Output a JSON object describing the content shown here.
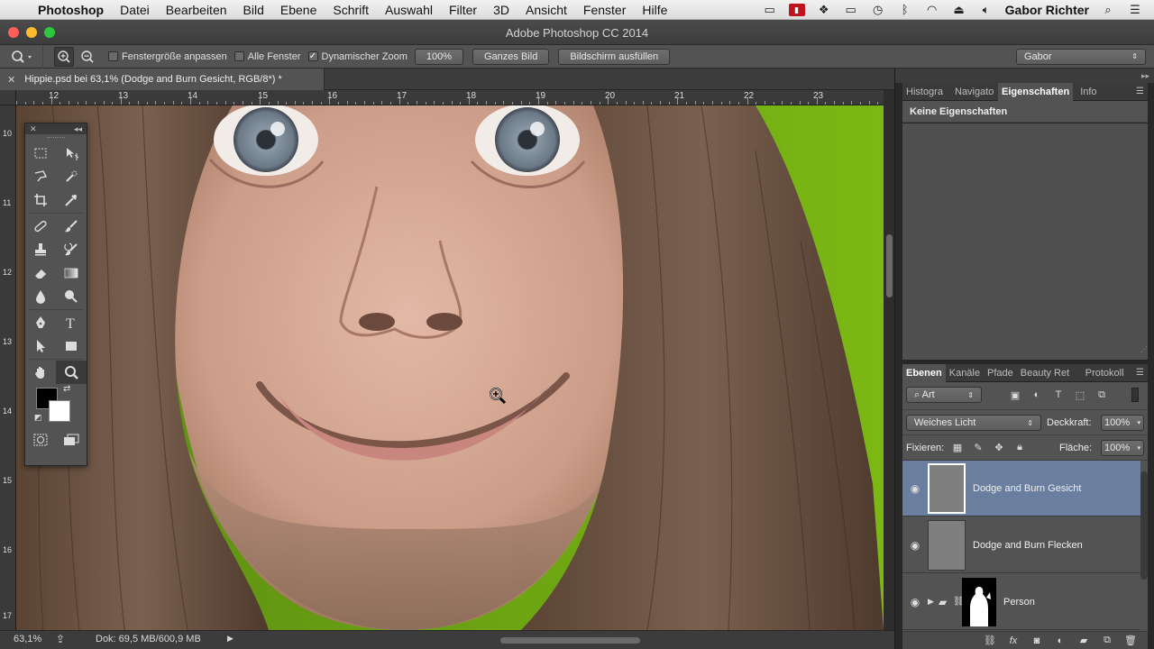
{
  "menubar": {
    "app": "Photoshop",
    "items": [
      "Datei",
      "Bearbeiten",
      "Bild",
      "Ebene",
      "Schrift",
      "Auswahl",
      "Filter",
      "3D",
      "Ansicht",
      "Fenster",
      "Hilfe"
    ],
    "user": "Gabor Richter"
  },
  "window": {
    "title": "Adobe Photoshop CC 2014"
  },
  "options": {
    "fit_window": "Fenstergröße anpassen",
    "all_windows": "Alle Fenster",
    "scrubby_zoom": "Dynamischer Zoom",
    "pct_button": "100%",
    "fit_screen": "Ganzes Bild",
    "fill_screen": "Bildschirm ausfüllen",
    "workspace": "Gabor"
  },
  "document": {
    "tab_title": "Hippie.psd bei 63,1% (Dodge and Burn Gesicht, RGB/8*) *"
  },
  "ruler": {
    "h_labels": [
      "12",
      "13",
      "14",
      "15",
      "16",
      "17",
      "18",
      "19",
      "20",
      "21",
      "22",
      "23"
    ],
    "v_labels": [
      "10",
      "11",
      "12",
      "13",
      "14",
      "15",
      "16",
      "17"
    ]
  },
  "status": {
    "zoom": "63,1%",
    "doc": "Dok: 69,5 MB/600,9 MB"
  },
  "properties_panel": {
    "tabs": [
      "Histogra",
      "Navigato",
      "Eigenschaften",
      "Info"
    ],
    "active_tab": 2,
    "content": "Keine Eigenschaften"
  },
  "layers_panel": {
    "tabs": [
      "Ebenen",
      "Kanäle",
      "Pfade",
      "Beauty Ret",
      "Protokoll"
    ],
    "active_tab": 0,
    "filter": "Art",
    "blend_mode": "Weiches Licht",
    "opacity_label": "Deckkraft:",
    "opacity": "100%",
    "lock_label": "Fixieren:",
    "fill_label": "Fläche:",
    "fill": "100%",
    "layers": [
      {
        "name": "Dodge and Burn Gesicht",
        "selected": true
      },
      {
        "name": "Dodge and Burn Flecken",
        "selected": false
      },
      {
        "name": "Person",
        "selected": false
      }
    ]
  },
  "colors": {
    "foreground": "#000000",
    "background": "#ffffff",
    "selection": "#6a7ea0",
    "backdrop_green": "#6a9e10"
  }
}
